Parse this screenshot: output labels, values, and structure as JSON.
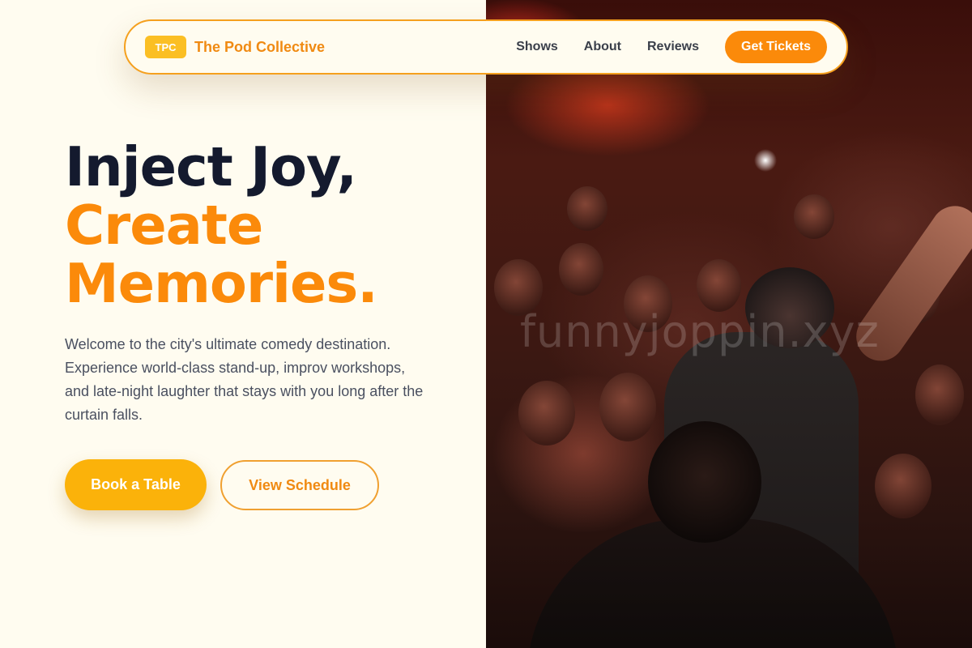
{
  "nav": {
    "badge": "TPC",
    "brand": "The Pod Collective",
    "links": [
      "Shows",
      "About",
      "Reviews"
    ],
    "cta": "Get Tickets"
  },
  "hero": {
    "title_line1": "Inject Joy,",
    "title_line2": "Create",
    "title_line3": "Memories.",
    "description": "Welcome to the city's ultimate comedy destination. Experience world-class stand-up, improv workshops, and late-night laughter that stays with you long after the curtain falls.",
    "primary_button": "Book a Table",
    "secondary_button": "View Schedule"
  },
  "photo": {
    "watermark": "funnyjoppin.xyz"
  },
  "colors": {
    "accent": "#fb8a0a",
    "badge": "#fbbf24",
    "primary_button": "#fbb20a",
    "heading_dark": "#141a2e",
    "background": "#fffcf0"
  }
}
